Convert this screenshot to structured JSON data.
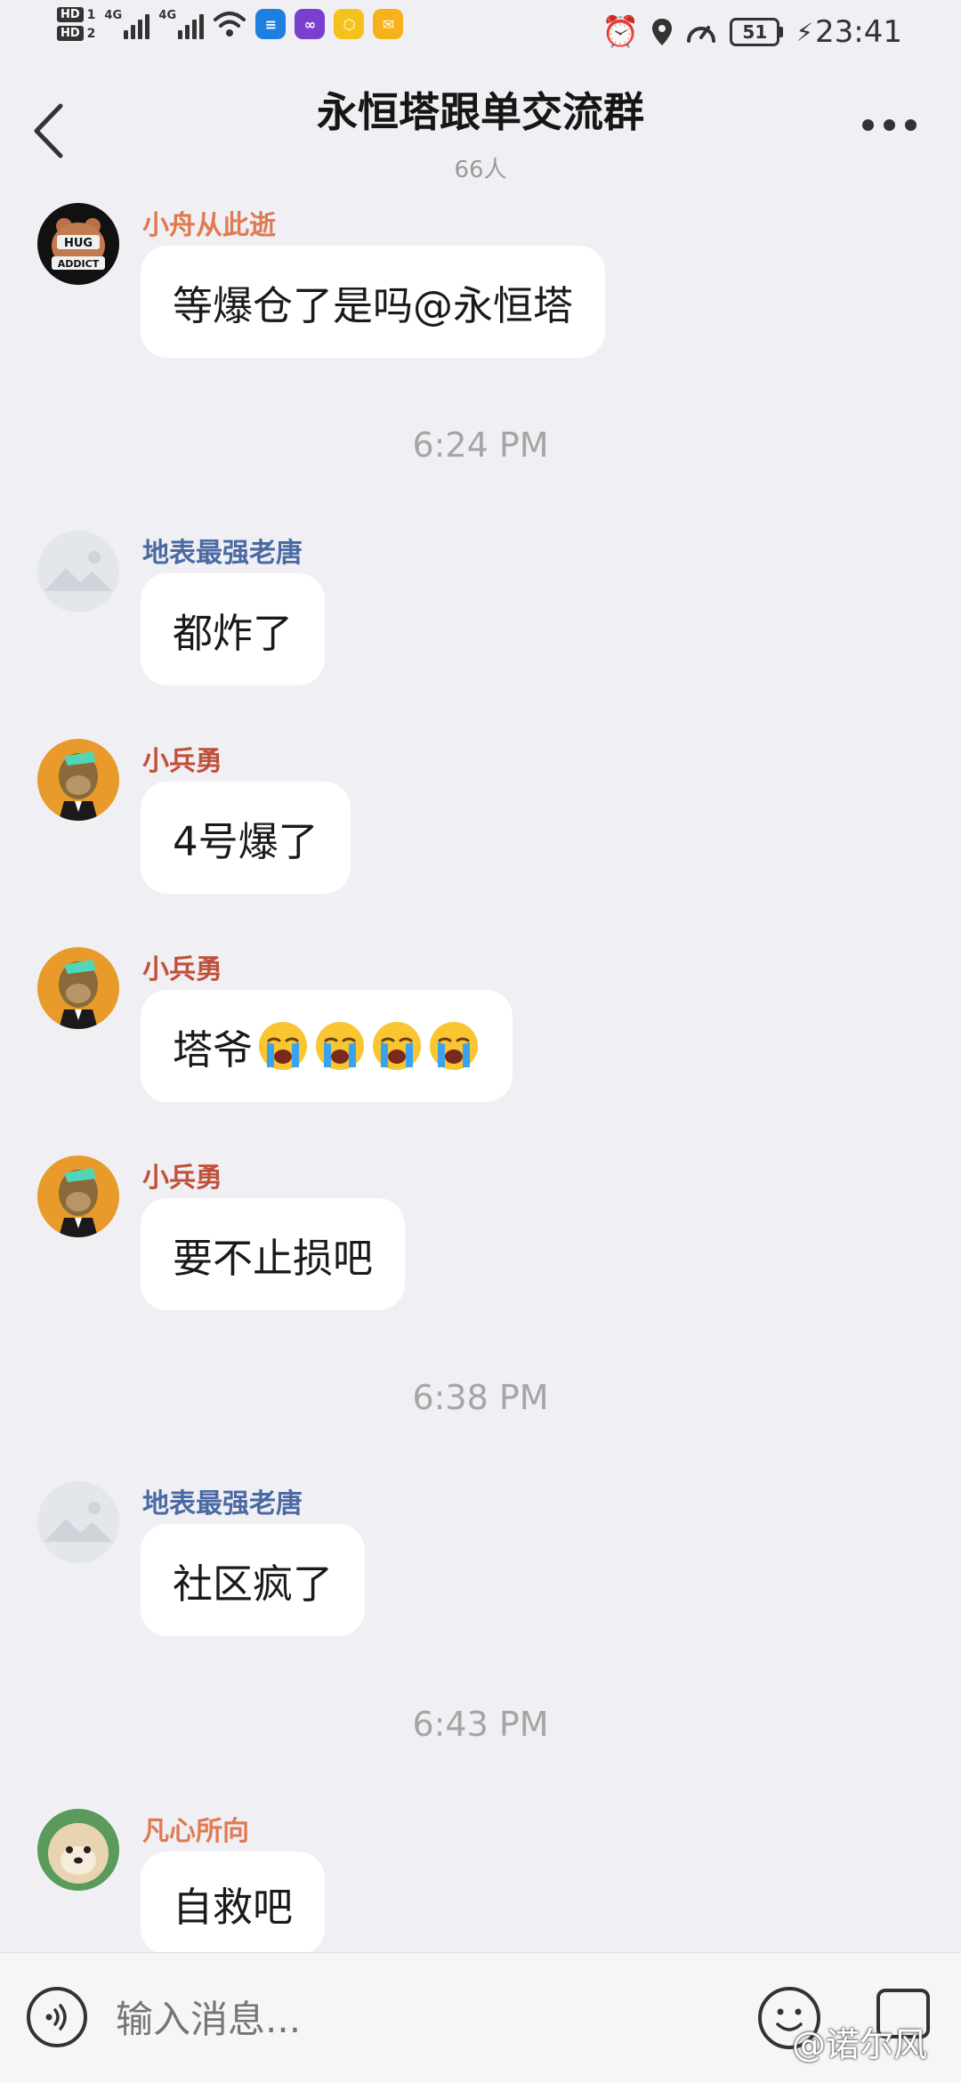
{
  "status_bar": {
    "hd1": "HD",
    "hd1_num": "1",
    "hd2": "HD",
    "hd2_num": "2",
    "net1": "4G",
    "net2": "4G",
    "battery": "51",
    "time": "23:41",
    "icons": [
      "signal-icon",
      "wifi-icon",
      "app-notification-icon",
      "alarm-icon",
      "location-icon",
      "speed-icon",
      "battery-icon",
      "charging-icon"
    ]
  },
  "header": {
    "title": "永恒塔跟单交流群",
    "member_count": "66人"
  },
  "messages": [
    {
      "sender": "小舟从此逝",
      "text": "等爆仓了是吗@永恒塔",
      "name_color": "#e07a52",
      "avatar": "hug-addict-avatar"
    },
    {
      "time": "6:24 PM"
    },
    {
      "sender": "地表最强老唐",
      "text": "都炸了",
      "name_color": "#4a6aa3",
      "avatar": "placeholder-avatar"
    },
    {
      "sender": "小兵勇",
      "text": "4号爆了",
      "name_color": "#c0503a",
      "avatar": "ape-avatar"
    },
    {
      "sender": "小兵勇",
      "text": "塔爷",
      "emoji": "loudly-crying-face-icon",
      "emoji_count": 4,
      "name_color": "#c0503a",
      "avatar": "ape-avatar"
    },
    {
      "sender": "小兵勇",
      "text": "要不止损吧",
      "name_color": "#c0503a",
      "avatar": "ape-avatar"
    },
    {
      "time": "6:38 PM"
    },
    {
      "sender": "地表最强老唐",
      "text": "社区疯了",
      "name_color": "#4a6aa3",
      "avatar": "placeholder-avatar"
    },
    {
      "time": "6:43 PM"
    },
    {
      "sender": "凡心所向",
      "text": "自救吧",
      "name_color": "#e07a52",
      "avatar": "dog-avatar"
    }
  ],
  "input_bar": {
    "placeholder": "输入消息...",
    "watermark": "@诺尔风"
  }
}
